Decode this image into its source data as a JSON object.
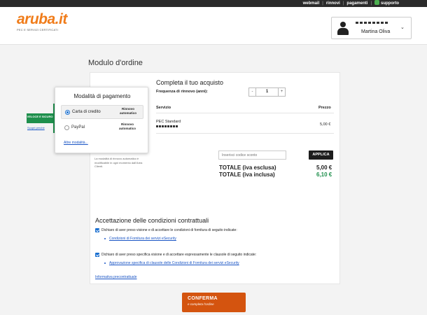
{
  "topbar": {
    "links": [
      "webmail",
      "rinnovi",
      "pagamenti",
      "supporto"
    ]
  },
  "header": {
    "logo_text": "aruba.it",
    "logo_subtitle": "PEC E SERVIZI CERTIFICATI",
    "user_name": "Martina Oliva"
  },
  "page_title": "Modulo d'ordine",
  "purchase": {
    "title": "Completa il tuo acquisto",
    "frequency_label": "Frequenza di rinnovo (anni):",
    "frequency_value": "1",
    "decrement": "-",
    "increment": "+",
    "col_service": "Servizio",
    "col_price": "Prezzo",
    "service_name": "PEC Standard",
    "service_price": "5,00 €"
  },
  "payment": {
    "title": "Modalità di pagamento",
    "options": [
      {
        "label": "Carta di credito",
        "note": "Rinnovo automatico",
        "selected": true
      },
      {
        "label": "PayPal",
        "note": "Rinnovo automatico",
        "selected": false
      }
    ],
    "more_link": "Altre modalità...",
    "badge": "VELOCE E SICURO",
    "badge_link": "Scopri perché",
    "renew_note": "La modalità di rinnovo automatico è modificabile in ogni momento dall'Area Clienti."
  },
  "discount": {
    "placeholder": "Inserisci codice sconto",
    "apply_label": "APPLICA"
  },
  "totals": {
    "excl_label": "TOTALE (iva esclusa)",
    "excl_value": "5,00 €",
    "incl_label": "TOTALE (iva inclusa)",
    "incl_value": "6,10 €"
  },
  "acceptance": {
    "title": "Accettazione delle condizioni contrattuali",
    "check1": "Dichiaro di aver preso visione e di accettare le condizioni di fornitura di seguito indicate:",
    "link1": "Condizioni di Fornitura dei servizi eSecurity",
    "check2": "Dichiaro di aver preso specifica visione e di accettare espressamente le clausole di seguito indicate:",
    "link2": "Approvazione specifica di clausole delle Condizioni di Fornitura dei servizi eSecurity",
    "info_link": "Informativa precontrattuale"
  },
  "confirm": {
    "label": "CONFERMA",
    "sublabel": "e completa l'ordine"
  },
  "colors": {
    "brand_orange": "#f07c1a",
    "confirm_orange": "#d4540f",
    "green": "#1e8f4c",
    "link_blue": "#1a55c5"
  }
}
